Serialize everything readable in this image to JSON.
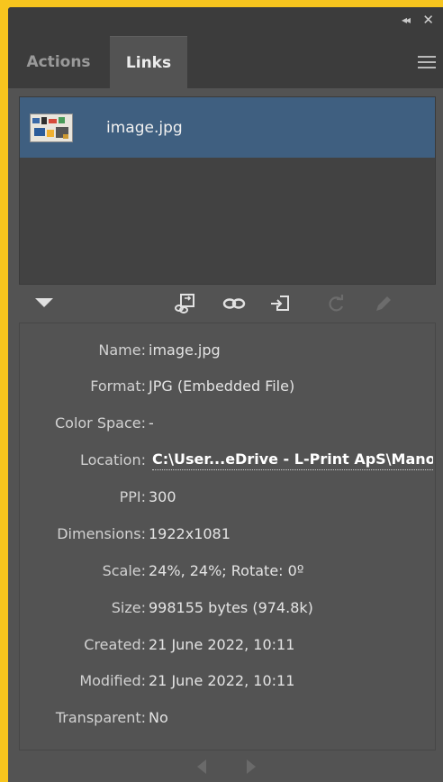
{
  "header": {
    "collapse_glyph": "◂◂",
    "close_glyph": "✕"
  },
  "tabs": [
    {
      "label": "Actions",
      "active": false
    },
    {
      "label": "Links",
      "active": true
    }
  ],
  "links_list": [
    {
      "name": "image.jpg",
      "selected": true
    }
  ],
  "toolbar_icons": [
    "relink-from-libraries-icon",
    "relink-icon",
    "go-to-link-icon",
    "update-link-icon",
    "edit-original-icon"
  ],
  "info": {
    "name": {
      "label": "Name:",
      "value": "image.jpg"
    },
    "format": {
      "label": "Format:",
      "value": "JPG (Embedded File)"
    },
    "color_space": {
      "label": "Color Space:",
      "value": "-"
    },
    "location": {
      "label": "Location:",
      "value": "C:\\User...eDrive - L-Print ApS\\Mano"
    },
    "ppi": {
      "label": "PPI:",
      "value": "300"
    },
    "dimensions": {
      "label": "Dimensions:",
      "value": "1922x1081"
    },
    "scale": {
      "label": "Scale:",
      "value": "24%, 24%; Rotate: 0º"
    },
    "size": {
      "label": "Size:",
      "value": "998155 bytes (974.8k)"
    },
    "created": {
      "label": "Created:",
      "value": "21 June 2022, 10:11"
    },
    "modified": {
      "label": "Modified:",
      "value": "21 June 2022, 10:11"
    },
    "transparent": {
      "label": "Transparent:",
      "value": "No"
    }
  },
  "colors": {
    "panel_bg": "#535353",
    "tabbar_bg": "#3c3c3c",
    "selection": "#3f5f80",
    "frame": "#f7c51e"
  }
}
